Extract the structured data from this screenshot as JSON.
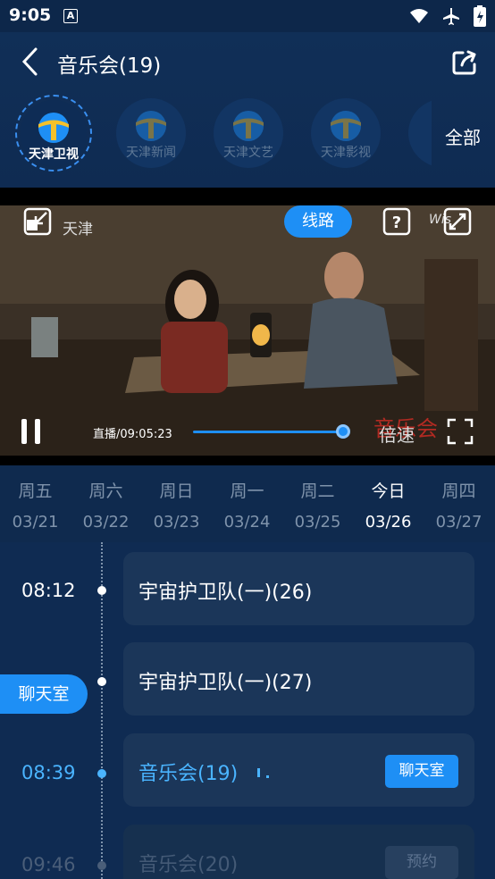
{
  "status": {
    "time": "9:05",
    "notification_icon": "A"
  },
  "header": {
    "title": "音乐会(19)"
  },
  "channels": [
    {
      "label": "天津卫视",
      "active": true
    },
    {
      "label": "天津新闻",
      "active": false
    },
    {
      "label": "天津文艺",
      "active": false
    },
    {
      "label": "天津影视",
      "active": false
    }
  ],
  "all_label": "全部",
  "player": {
    "watermark": "天津",
    "route_label": "线路",
    "live_time": "直播/09:05:23",
    "speed_label": "倍速",
    "progress": 1.0
  },
  "days": [
    {
      "name": "周五",
      "date": "03/21"
    },
    {
      "name": "周六",
      "date": "03/22"
    },
    {
      "name": "周日",
      "date": "03/23"
    },
    {
      "name": "周一",
      "date": "03/24"
    },
    {
      "name": "周二",
      "date": "03/25"
    },
    {
      "name": "今日",
      "date": "03/26",
      "active": true
    },
    {
      "name": "周四",
      "date": "03/27"
    }
  ],
  "programs": [
    {
      "time": "08:12",
      "title": "宇宙护卫队(一)(26)",
      "state": "past"
    },
    {
      "time": "",
      "title": "宇宙护卫队(一)(27)",
      "state": "past"
    },
    {
      "time": "08:39",
      "title": "音乐会(19)",
      "state": "live",
      "button": "聊天室"
    },
    {
      "time": "09:46",
      "title": "音乐会(20)",
      "state": "future",
      "button": "预约"
    }
  ],
  "chat_float": "聊天室",
  "colors": {
    "accent": "#1e8ff5",
    "live_text": "#4ab4ff",
    "background": "#0f2b52"
  }
}
